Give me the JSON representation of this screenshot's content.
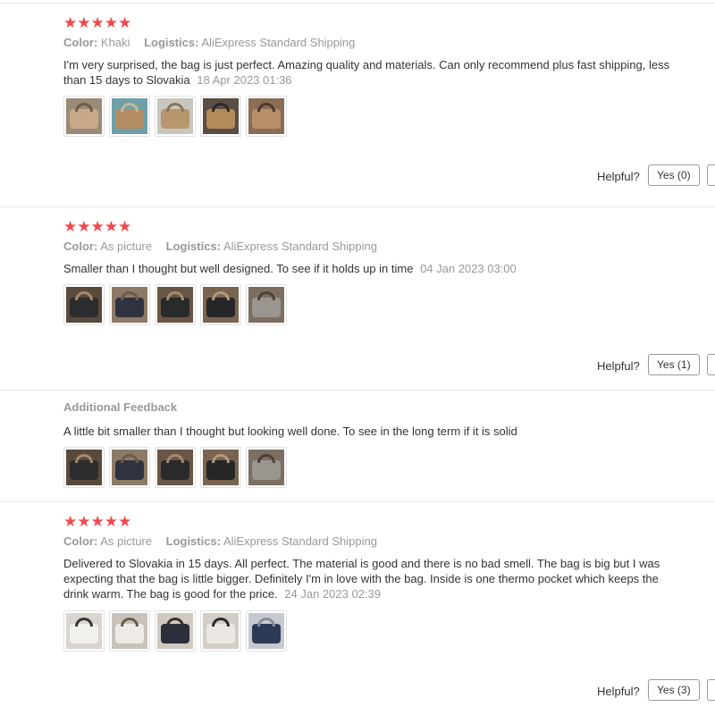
{
  "reviews": [
    {
      "stars": "★★★★★",
      "color_label": "Color:",
      "color_value": "Khaki",
      "logistics_label": "Logistics:",
      "logistics_value": "AliExpress Standard Shipping",
      "text": "I'm very surprised, the bag is just perfect. Amazing quality and materials. Can only recommend plus fast shipping, less than 15 days to Slovakia",
      "date": "18 Apr 2023 01:36",
      "helpful_label": "Helpful?",
      "yes_label": "Yes (0)"
    },
    {
      "stars": "★★★★★",
      "color_label": "Color:",
      "color_value": "As picture",
      "logistics_label": "Logistics:",
      "logistics_value": "AliExpress Standard Shipping",
      "text": "Smaller than I thought but well designed. To see if it holds up in time",
      "date": "04 Jan 2023 03:00",
      "helpful_label": "Helpful?",
      "yes_label": "Yes (1)",
      "additional_title": "Additional Feedback",
      "additional_text": "A little bit smaller than I thought but looking well done. To see in the long term if it is solid"
    },
    {
      "stars": "★★★★★",
      "color_label": "Color:",
      "color_value": "As picture",
      "logistics_label": "Logistics:",
      "logistics_value": "AliExpress Standard Shipping",
      "text": "Delivered to Slovakia in 15 days. All perfect. The material is good and there is no bad smell. The bag is big but I was expecting that the bag is little bigger. Definitely I'm in love with the bag. Inside is one thermo pocket which keeps the drink warm. The bag is good for the price.",
      "date": "24 Jan 2023 02:39",
      "helpful_label": "Helpful?",
      "yes_label": "Yes (3)"
    }
  ],
  "colors": {
    "star": "#f5484a",
    "muted": "#999999",
    "text": "#333333",
    "border": "#e8e8e8"
  }
}
